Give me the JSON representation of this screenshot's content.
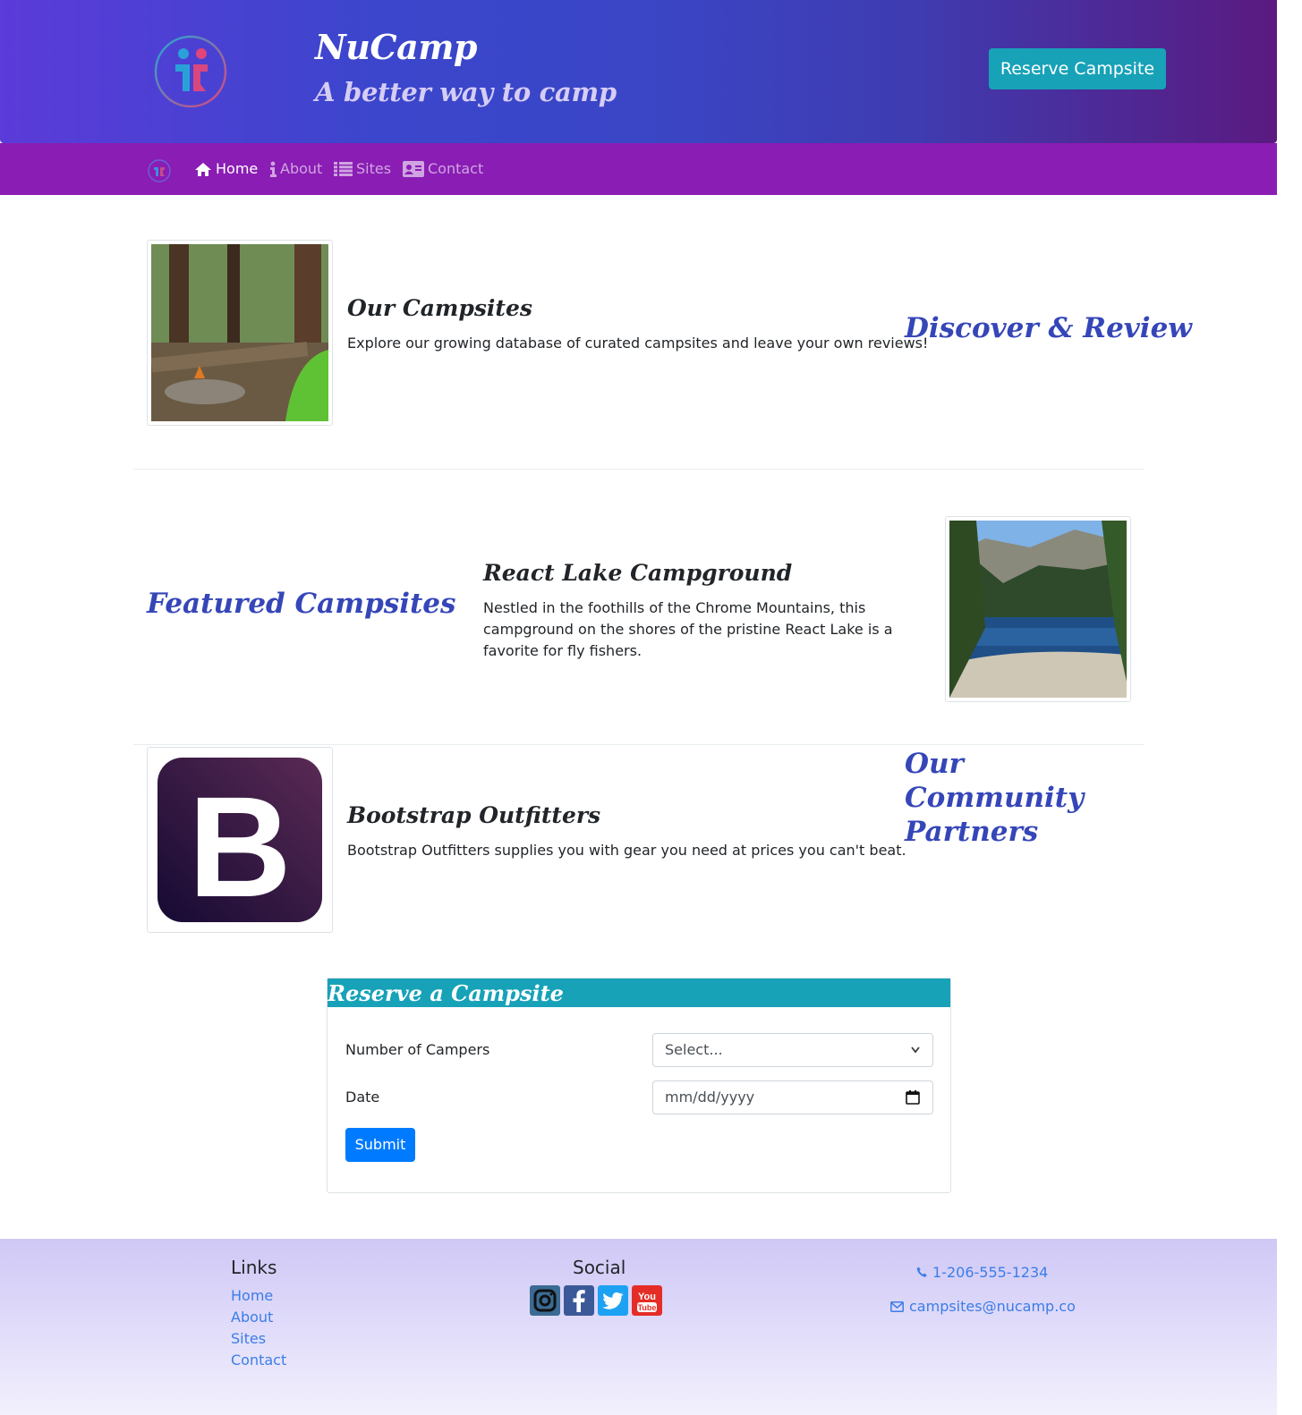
{
  "header": {
    "brand_title": "NuCamp",
    "brand_tagline": "A better way to camp",
    "reserve_button": "Reserve Campsite"
  },
  "navbar": {
    "items": [
      {
        "label": "Home",
        "icon": "home-icon",
        "active": true
      },
      {
        "label": "About",
        "icon": "info-icon",
        "active": false
      },
      {
        "label": "Sites",
        "icon": "list-icon",
        "active": false
      },
      {
        "label": "Contact",
        "icon": "address-card-icon",
        "active": false
      }
    ]
  },
  "sections": {
    "campsites": {
      "title": "Our Campsites",
      "text": "Explore our growing database of curated campsites and leave your own reviews!",
      "side_heading": "Discover & Review"
    },
    "featured": {
      "side_heading": "Featured Campsites",
      "title": "React Lake Campground",
      "text": "Nestled in the foothills of the Chrome Mountains, this campground on the shores of the pristine React Lake is a favorite for fly fishers."
    },
    "partners": {
      "title": "Bootstrap Outfitters",
      "text": "Bootstrap Outfitters supplies you with gear you need at prices you can't beat.",
      "side_heading": "Our Community Partners",
      "logo_letter": "B"
    }
  },
  "reserve_form": {
    "heading": "Reserve a Campsite",
    "campers_label": "Number of Campers",
    "campers_value": "Select...",
    "date_label": "Date",
    "date_placeholder": "mm/dd/yyyy",
    "submit_label": "Submit"
  },
  "footer": {
    "links_heading": "Links",
    "links": [
      "Home",
      "About",
      "Sites",
      "Contact"
    ],
    "social_heading": "Social",
    "social_icons": [
      "instagram-icon",
      "facebook-icon",
      "twitter-icon",
      "youtube-icon"
    ],
    "phone": "1-206-555-1234",
    "email": "campsites@nucamp.co"
  },
  "colors": {
    "navbar": "#8a1db4",
    "accent_teal": "#17a2b8",
    "heading_blue": "#3546b8",
    "link_blue": "#3b7de8",
    "submit_blue": "#007bff"
  }
}
